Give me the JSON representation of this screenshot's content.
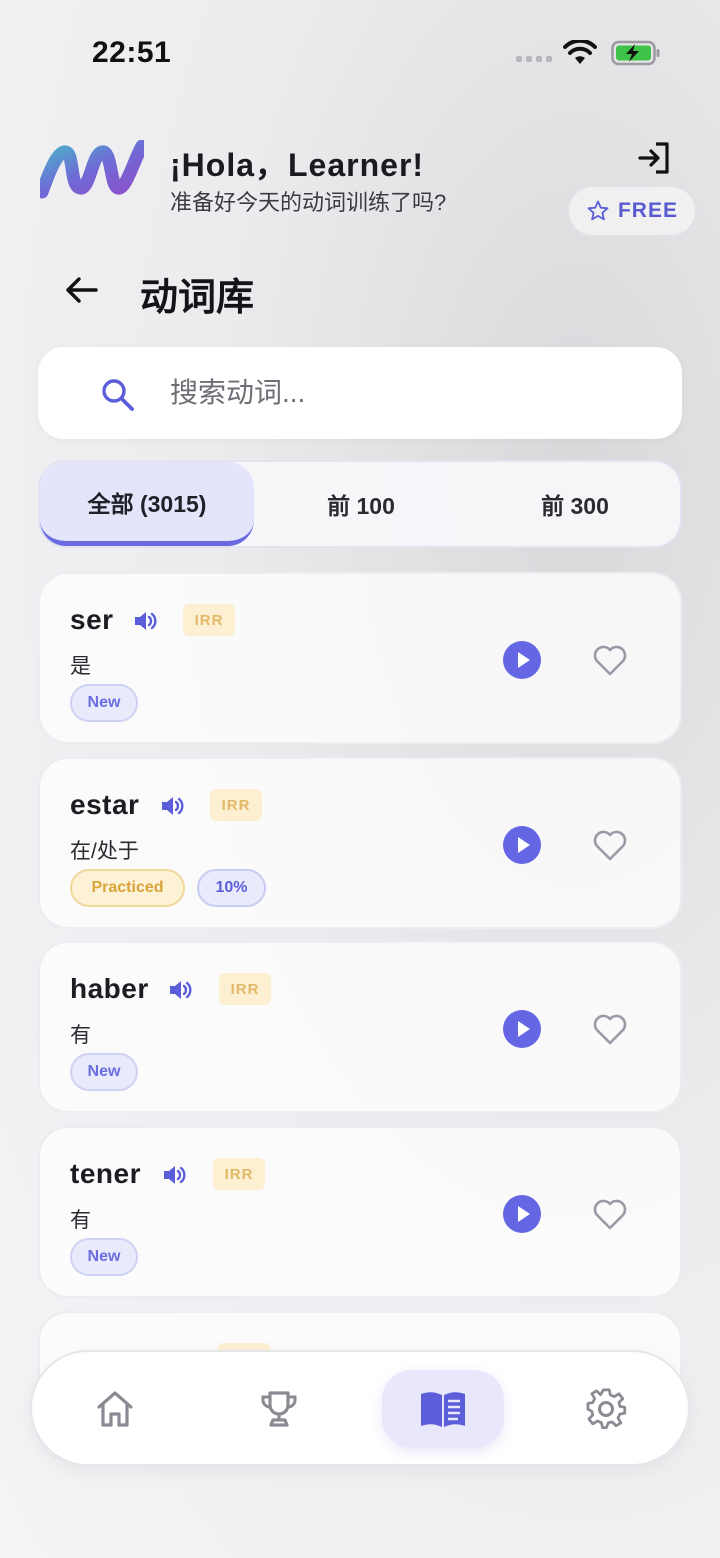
{
  "status_bar": {
    "time": "22:51"
  },
  "header": {
    "greeting": "¡Hola，Learner!",
    "subtitle": "准备好今天的动词训练了吗?",
    "plan_badge": "FREE"
  },
  "page": {
    "title": "动词库"
  },
  "search": {
    "placeholder": "搜索动词..."
  },
  "tabs": [
    {
      "label": "全部 (3015)",
      "active": true
    },
    {
      "label": "前 100",
      "active": false
    },
    {
      "label": "前 300",
      "active": false
    }
  ],
  "verbs": [
    {
      "verb": "ser",
      "irregular_label": "IRR",
      "meaning": "是",
      "tags": [
        "New"
      ]
    },
    {
      "verb": "estar",
      "irregular_label": "IRR",
      "meaning": "在/处于",
      "tags": [
        "Practiced",
        "10%"
      ]
    },
    {
      "verb": "haber",
      "irregular_label": "IRR",
      "meaning": "有",
      "tags": [
        "New"
      ]
    },
    {
      "verb": "tener",
      "irregular_label": "IRR",
      "meaning": "有",
      "tags": [
        "New"
      ]
    }
  ],
  "bottom_nav": [
    {
      "icon": "home-icon",
      "active": false
    },
    {
      "icon": "trophy-icon",
      "active": false
    },
    {
      "icon": "book-icon",
      "active": true
    },
    {
      "icon": "gear-icon",
      "active": false
    }
  ],
  "colors": {
    "accent": "#5b5ed8",
    "play_button": "#6466e3",
    "irr_badge_bg": "#fcefd2",
    "irr_badge_text": "#e3b867",
    "practiced_bg": "#fdf1d6"
  }
}
